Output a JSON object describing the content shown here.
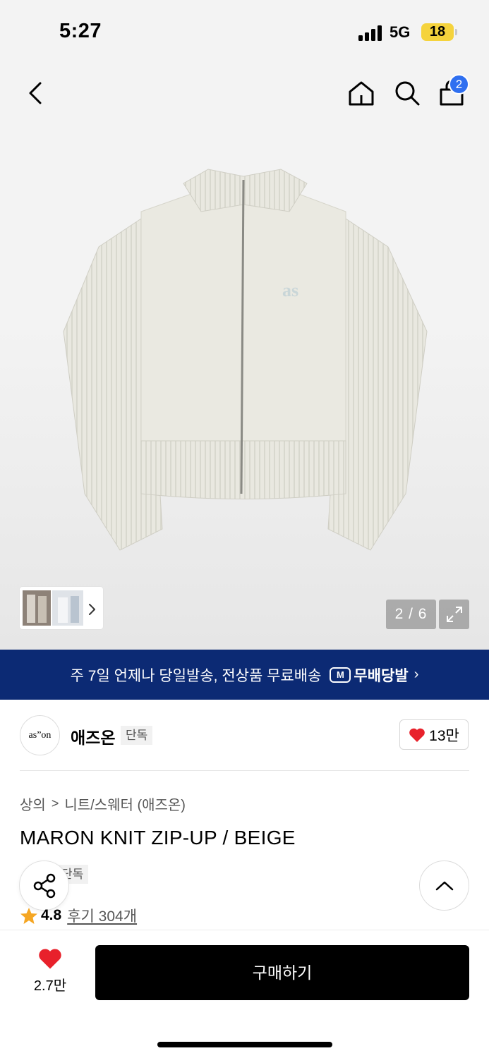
{
  "status": {
    "time": "5:27",
    "network": "5G",
    "battery": "18"
  },
  "header": {
    "cart_count": "2"
  },
  "gallery": {
    "counter": "2 / 6"
  },
  "banner": {
    "text": "주 7일 언제나 당일발송, 전상품 무료배송",
    "logo_text": "무배당발",
    "logo_mark": "M"
  },
  "brand": {
    "logo_text": "as”on",
    "name": "애즈온",
    "exclusive": "단독",
    "likes": "13만"
  },
  "product": {
    "breadcrumb": [
      "상의",
      "니트/스웨터 (애즈온)"
    ],
    "title": "MARON KNIT ZIP-UP / BEIGE",
    "exclusive": "단독",
    "rating": "4.8",
    "reviews": "후기 304개"
  },
  "bottom": {
    "wish_count": "2.7만",
    "buy_label": "구매하기"
  },
  "colors": {
    "banner_bg": "#0c2a74",
    "badge_blue": "#2f6ff0",
    "heart_red": "#e8212b",
    "star": "#f5a623"
  }
}
